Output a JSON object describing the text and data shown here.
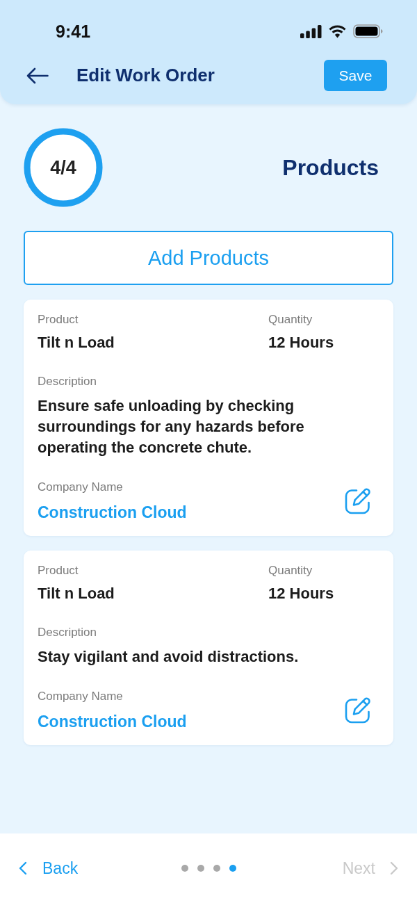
{
  "status_bar": {
    "time": "9:41"
  },
  "header": {
    "title": "Edit Work Order",
    "save_button": "Save"
  },
  "step": {
    "counter": "4/4",
    "level": 1,
    "title": "Products"
  },
  "add_button": "Add Products",
  "products": [
    {
      "product_label": "Product",
      "product": "Tilt n Load",
      "quantity_label": "Quantity",
      "quantity": "12 Hours",
      "description_label": "Description",
      "description": "Ensure safe unloading by checking surroundings for any hazards before operating the concrete chute.",
      "company_label": "Company Name",
      "company": "Construction Cloud"
    },
    {
      "product_label": "Product",
      "product": "Tilt n Load",
      "quantity_label": "Quantity",
      "quantity": "12 Hours",
      "description_label": "Description",
      "description": "Stay vigilant and avoid distractions.",
      "company_label": "Company Name",
      "company": "Construction Cloud"
    }
  ],
  "footer": {
    "back": {
      "label": "Back"
    },
    "steps": [
      {
        "selected": false
      },
      {
        "selected": false
      },
      {
        "selected": false
      },
      {
        "selected": true
      }
    ],
    "next": {
      "label": "Next",
      "disabled": true
    }
  }
}
